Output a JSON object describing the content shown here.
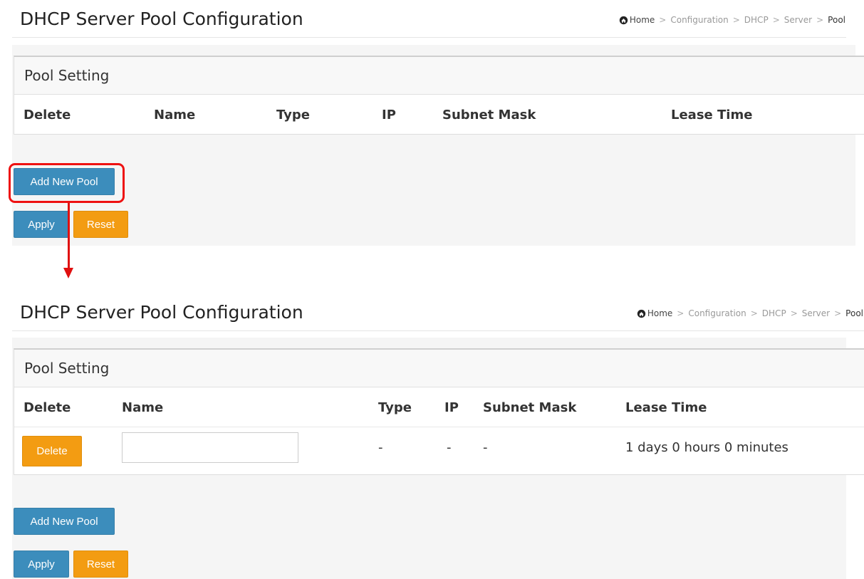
{
  "page": {
    "title": "DHCP Server Pool Configuration",
    "breadcrumb": [
      "Home",
      "Configuration",
      "DHCP",
      "Server",
      "Pool"
    ],
    "breadcrumb_separator": ">"
  },
  "pool_setting": {
    "title": "Pool Setting",
    "columns": [
      "Delete",
      "Name",
      "Type",
      "IP",
      "Subnet Mask",
      "Lease Time"
    ]
  },
  "before": {
    "rows": []
  },
  "after": {
    "rows": [
      {
        "delete_label": "Delete",
        "name_value": "",
        "type": "-",
        "ip": "-",
        "subnet_mask": "-",
        "lease_time": "1 days 0 hours 0 minutes"
      }
    ]
  },
  "buttons": {
    "add_new_pool": "Add New Pool",
    "apply": "Apply",
    "reset": "Reset"
  },
  "annotation": {
    "highlight_color": "#ee1111",
    "arrow_color": "#e01010"
  },
  "colors": {
    "primary_button": "#3c8dbc",
    "warning_button": "#f39c12",
    "panel_background": "#f5f5f5"
  },
  "icons": {
    "home": "home-icon"
  }
}
